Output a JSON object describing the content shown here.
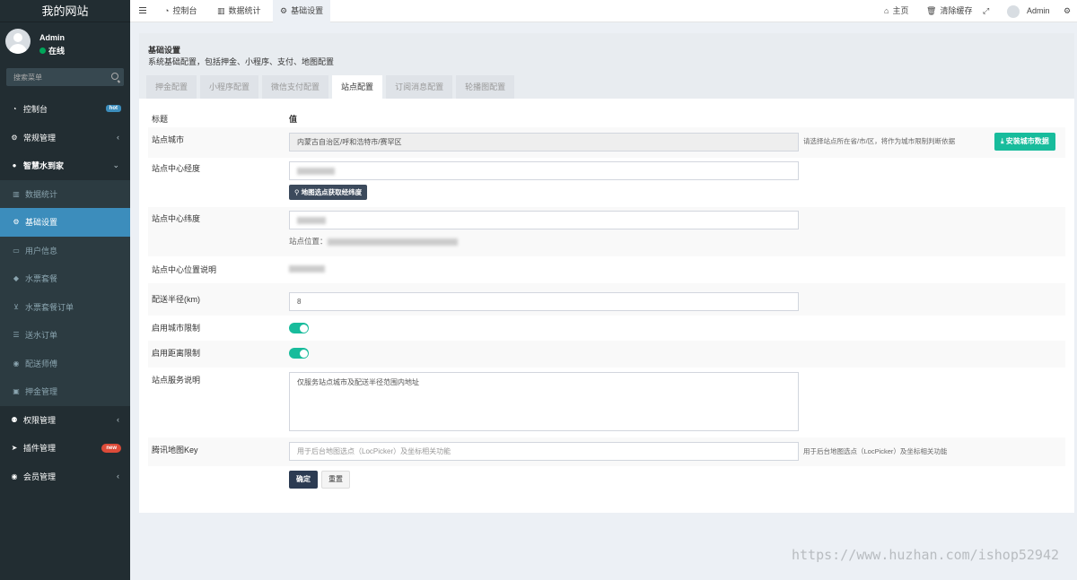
{
  "site": {
    "title": "我的网站"
  },
  "user": {
    "name": "Admin",
    "status": "在线"
  },
  "search": {
    "placeholder": "搜索菜单"
  },
  "menu": [
    {
      "label": "控制台",
      "icon": "dashboard-icon",
      "glyph": "◔",
      "badge": "hot"
    },
    {
      "label": "常规管理",
      "icon": "cogs-icon",
      "glyph": "⚙",
      "chevron": "‹"
    },
    {
      "label": "智慧水到家",
      "icon": "tint-icon",
      "glyph": "●",
      "chevron": "⌄"
    },
    {
      "label": "数据统计",
      "icon": "bar-chart-icon",
      "glyph": "▥"
    },
    {
      "label": "基础设置",
      "icon": "cog-icon",
      "glyph": "⚙"
    },
    {
      "label": "用户信息",
      "icon": "credit-card-icon",
      "glyph": "▭"
    },
    {
      "label": "水票套餐",
      "icon": "tag-icon",
      "glyph": "◆"
    },
    {
      "label": "水票套餐订单",
      "icon": "cart-icon",
      "glyph": "⊻"
    },
    {
      "label": "送水订单",
      "icon": "list-icon",
      "glyph": "☰"
    },
    {
      "label": "配送师傅",
      "icon": "user-circle-icon",
      "glyph": "◉"
    },
    {
      "label": "押金管理",
      "icon": "money-icon",
      "glyph": "▣"
    },
    {
      "label": "权限管理",
      "icon": "group-icon",
      "glyph": "⚉",
      "chevron": "‹"
    },
    {
      "label": "插件管理",
      "icon": "rocket-icon",
      "glyph": "➤",
      "badge": "new"
    },
    {
      "label": "会员管理",
      "icon": "user-circle-icon",
      "glyph": "◉",
      "chevron": "‹"
    }
  ],
  "topbar": {
    "tabs": [
      {
        "label": "控制台",
        "glyph": "◔"
      },
      {
        "label": "数据统计",
        "glyph": "▥"
      },
      {
        "label": "基础设置",
        "glyph": "⚙"
      }
    ],
    "home": "主页",
    "clear_cache": "清除缓存",
    "admin": "Admin"
  },
  "header": {
    "title": "基础设置",
    "description": "系统基础配置，包括押金、小程序、支付、地图配置"
  },
  "tabs": [
    {
      "label": "押金配置"
    },
    {
      "label": "小程序配置"
    },
    {
      "label": "微信支付配置"
    },
    {
      "label": "站点配置",
      "active": true
    },
    {
      "label": "订阅消息配置"
    },
    {
      "label": "轮播图配置"
    }
  ],
  "form": {
    "col_title": "标题",
    "col_value": "值",
    "city_label": "站点城市",
    "city_value": "内蒙古自治区/呼和浩特市/赛罕区",
    "city_help": "请选择站点所在省/市/区，将作为城市限制判断依据",
    "install_city_btn": "安装城市数据",
    "lng_label": "站点中心经度",
    "map_pick_btn": "地图选点获取经纬度",
    "lat_label": "站点中心纬度",
    "location_prefix": "站点位置：",
    "desc_label": "站点中心位置说明",
    "radius_label": "配送半径(km)",
    "radius_value": "8",
    "city_limit_label": "启用城市限制",
    "city_limit_on": true,
    "distance_limit_label": "启用距离限制",
    "distance_limit_on": true,
    "service_label": "站点服务说明",
    "service_value": "仅服务站点城市及配送半径范围内地址",
    "key_label": "腾讯地图Key",
    "key_placeholder": "用于后台地图选点（LocPicker）及坐标相关功能",
    "key_help": "用于后台地图选点（LocPicker）及坐标相关功能",
    "ok_btn": "确定",
    "reset_btn": "重置"
  },
  "watermark": "https://www.huzhan.com/ishop52942"
}
